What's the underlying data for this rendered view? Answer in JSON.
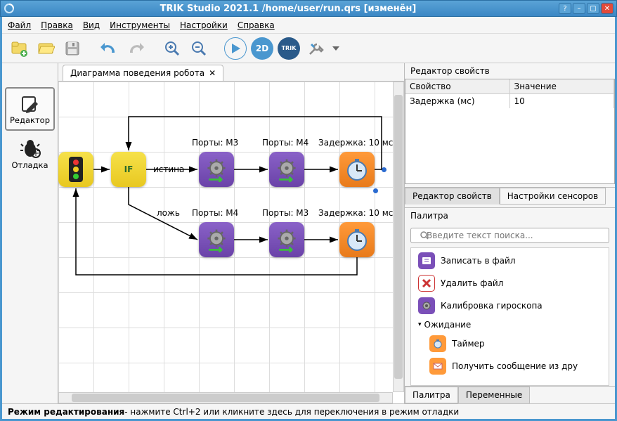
{
  "window_title": "TRIK Studio 2021.1 /home/user/run.qrs [изменён]",
  "menu": {
    "file": "Файл",
    "edit": "Правка",
    "view": "Вид",
    "tools": "Инструменты",
    "settings": "Настройки",
    "help": "Справка"
  },
  "sidebar": {
    "editor": "Редактор",
    "debug": "Отладка"
  },
  "tab": {
    "title": "Диаграмма поведения робота"
  },
  "blocks": {
    "if_true": "истина",
    "if_false": "ложь",
    "port_m3": "Порты: M3",
    "port_m4": "Порты: M4",
    "delay": "Задержка: 10 мс",
    "if_text": "IF"
  },
  "props": {
    "title": "Редактор свойств",
    "col_prop": "Свойство",
    "col_val": "Значение",
    "row_prop": "Задержка (мс)",
    "row_val": "10",
    "tab_props": "Редактор свойств",
    "tab_sensors": "Настройки сенсоров"
  },
  "palette": {
    "title": "Палитра",
    "search_ph": "Введите текст поиска...",
    "items": {
      "write": "Записать в файл",
      "delete": "Удалить файл",
      "gyro": "Калибровка  гироскопа",
      "group_wait": "Ожидание",
      "timer": "Таймер",
      "recv": "Получить сообщение из дру"
    },
    "tab_palette": "Палитра",
    "tab_vars": "Переменные"
  },
  "status": {
    "bold": "Режим редактирования",
    "rest": " - нажмите Ctrl+2 или кликните здесь для переключения в режим отладки"
  }
}
